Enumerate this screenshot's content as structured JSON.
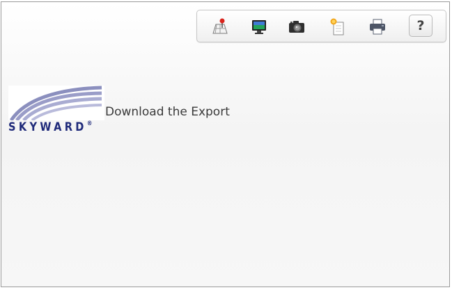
{
  "toolbar": {
    "icons": [
      "map-pin-icon",
      "monitor-icon",
      "camera-icon",
      "new-document-icon",
      "printer-icon"
    ],
    "help_label": "?"
  },
  "logo": {
    "text": "SKYWARD",
    "mark": "®",
    "brand_color": "#1f2a7a",
    "swoosh_color": "#8b8fbe"
  },
  "main": {
    "title": "Download the Export"
  }
}
